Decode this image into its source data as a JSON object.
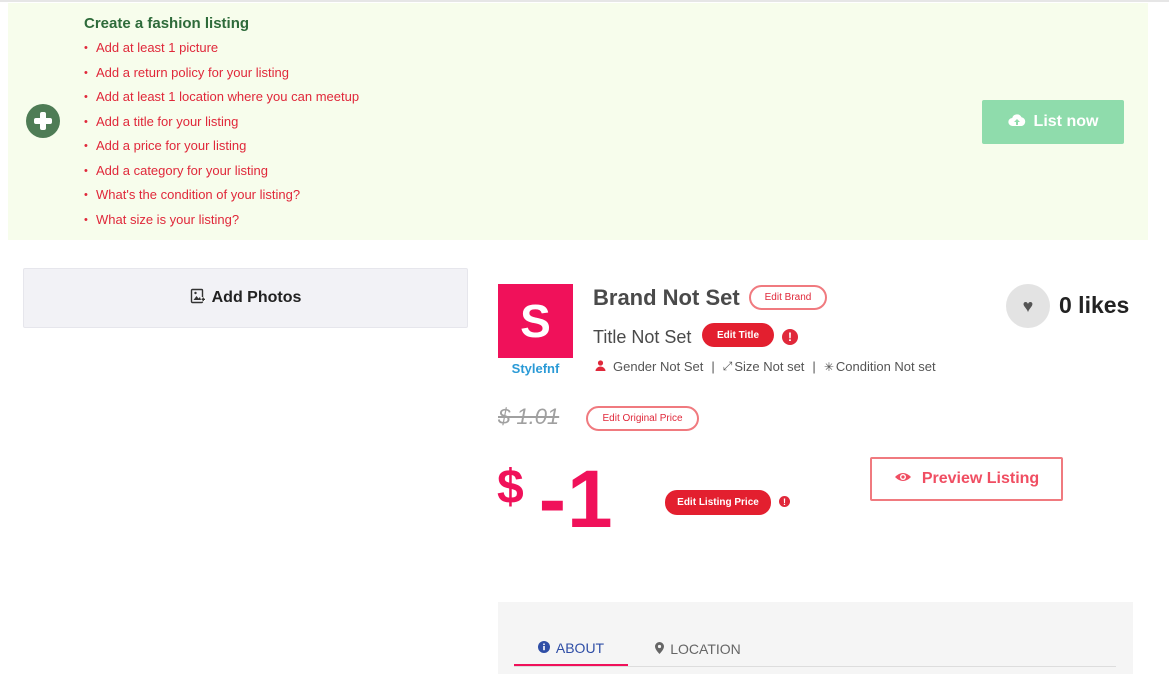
{
  "checklist": {
    "title": "Create a fashion listing",
    "items": [
      "Add at least 1 picture",
      "Add a return policy for your listing",
      "Add at least 1 location where you can meetup",
      "Add a title for your listing",
      "Add a price for your listing",
      "Add a category for your listing",
      "What's the condition of your listing?",
      "What size is your listing?"
    ],
    "list_now_label": "List now",
    "list_now_color": "#8fdcac"
  },
  "photos": {
    "add_photos_label": "Add Photos"
  },
  "store": {
    "logo_letter": "S",
    "name": "Stylefnf",
    "logo_color": "#f0115a"
  },
  "listing": {
    "brand": "Brand Not Set",
    "edit_brand_label": "Edit Brand",
    "title": "Title Not Set",
    "edit_title_label": "Edit Title",
    "alert_symbol": "!",
    "gender": "Gender Not Set",
    "size": "Size Not set",
    "condition": "Condition Not set",
    "separator": "|",
    "likes": "0 likes"
  },
  "pricing": {
    "original_price": "$ 1.01",
    "edit_original_label": "Edit Original Price",
    "currency": "$",
    "listing_price": "-1",
    "edit_listing_label": "Edit Listing Price",
    "preview_label": "Preview Listing",
    "accent_color": "#f0115a"
  },
  "tabs": [
    {
      "label": "ABOUT",
      "active": true
    },
    {
      "label": "LOCATION",
      "active": false
    }
  ]
}
